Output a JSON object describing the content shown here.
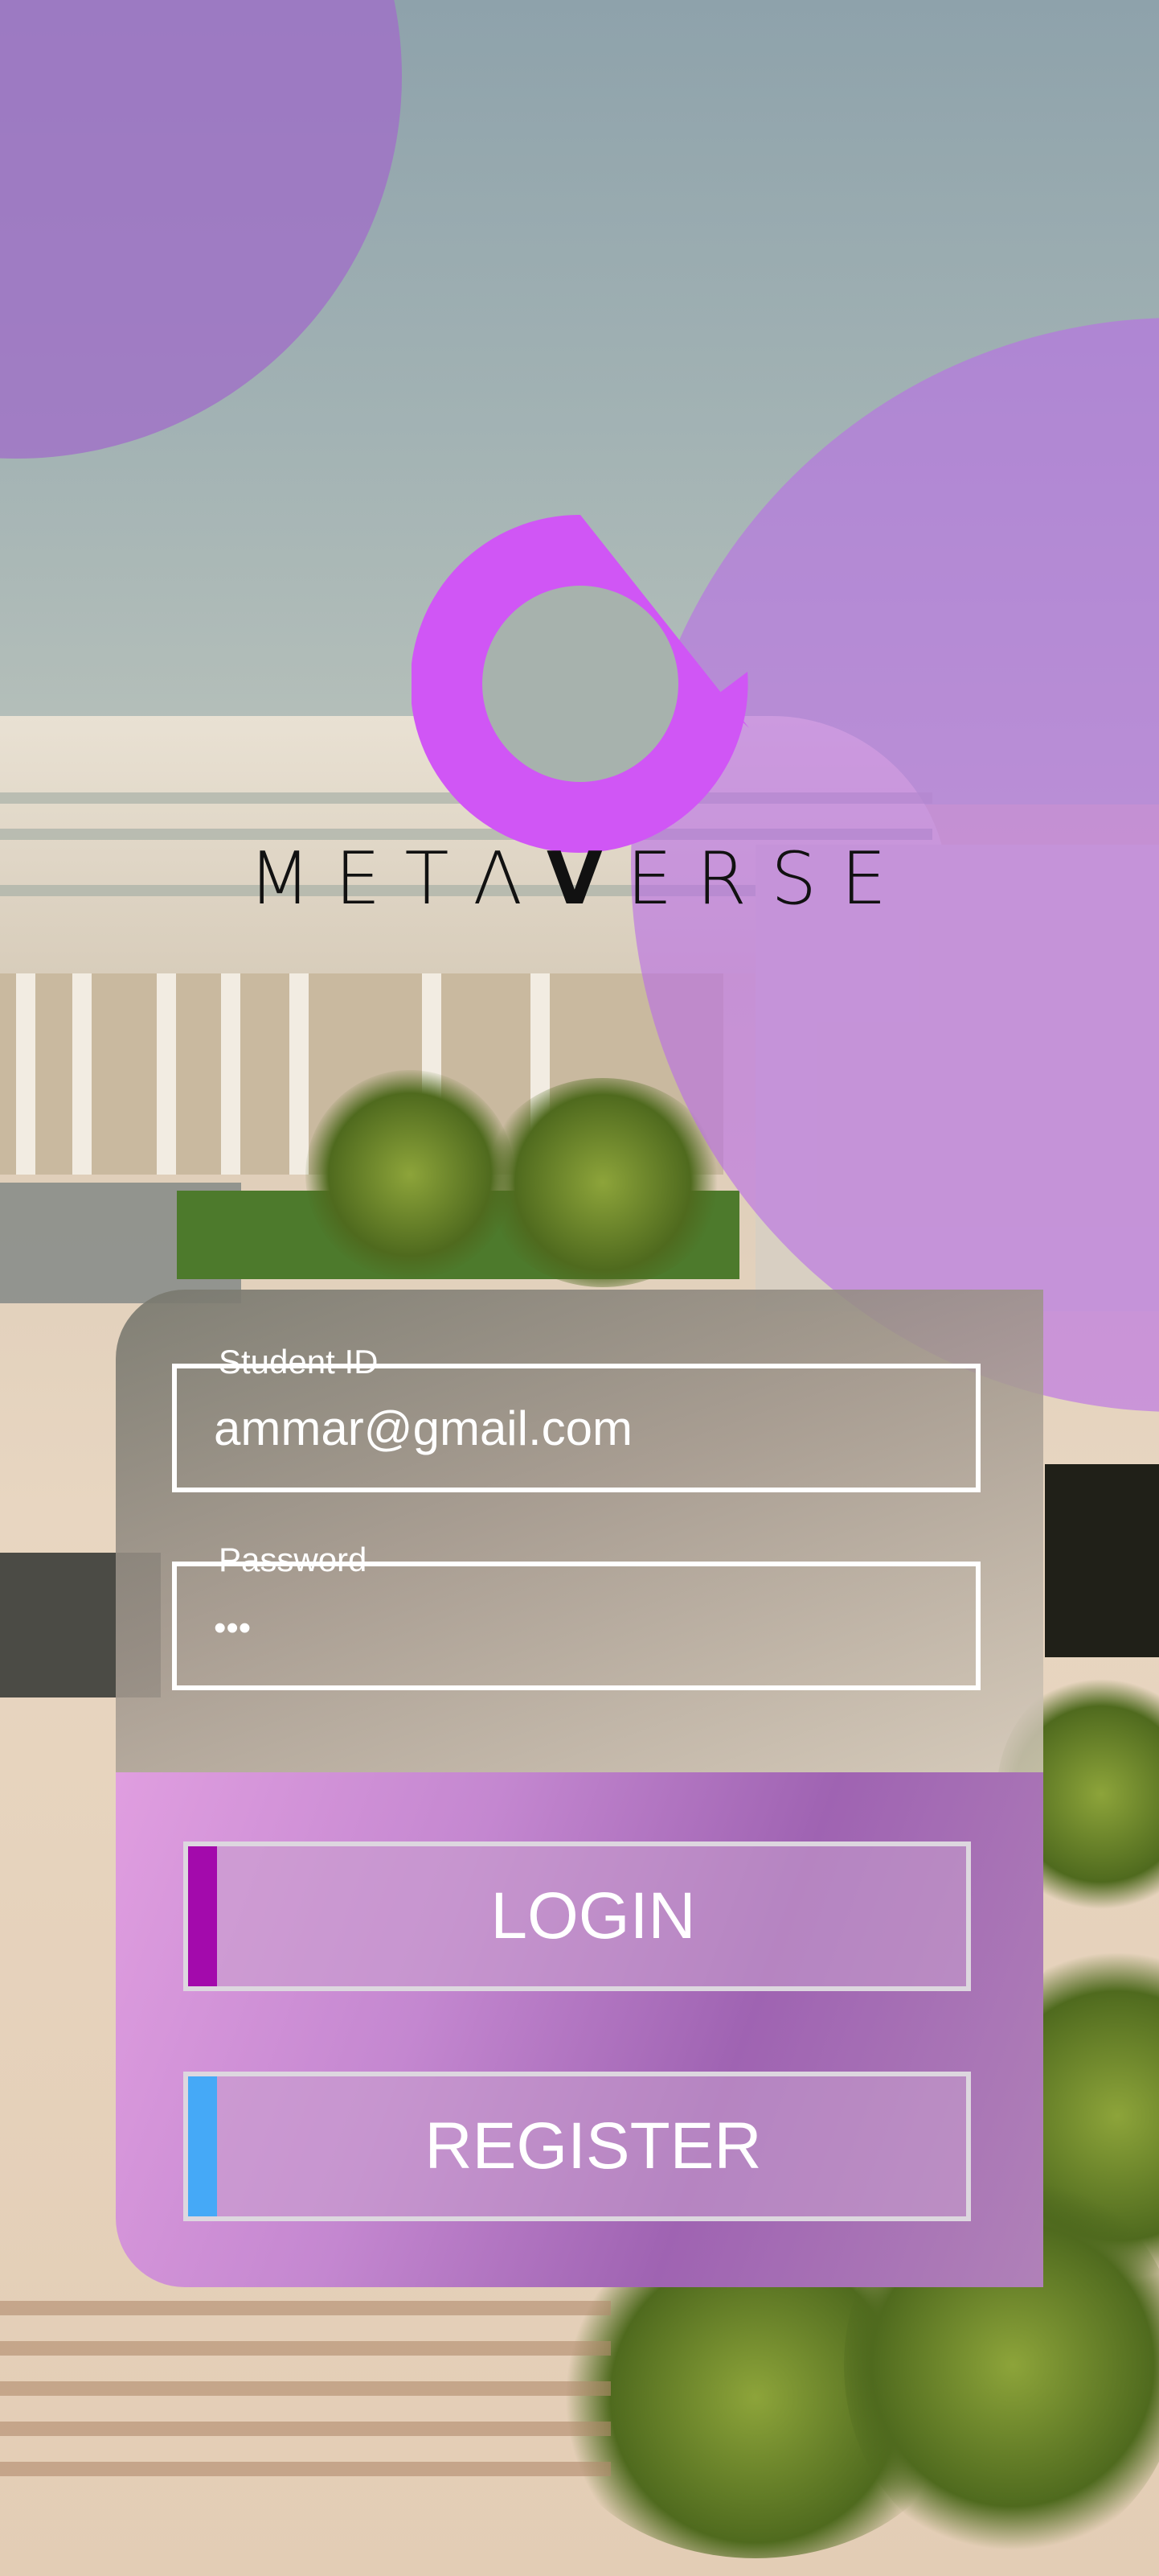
{
  "brand": {
    "name_part1": "METΛ",
    "name_part2": "V",
    "name_part3": "ERSE",
    "logo_color": "#d056f5",
    "text_color": "#111111"
  },
  "form": {
    "student_id": {
      "label": "Student ID",
      "value": "ammar@gmail.com"
    },
    "password": {
      "label": "Password",
      "value": "•••"
    }
  },
  "buttons": {
    "login_label": "LOGIN",
    "register_label": "REGISTER",
    "login_accent": "#a30aac",
    "register_accent": "#45a9f7"
  },
  "colors": {
    "overlay_purple": "#b96ee6",
    "card_bottom": "#c487d0"
  }
}
